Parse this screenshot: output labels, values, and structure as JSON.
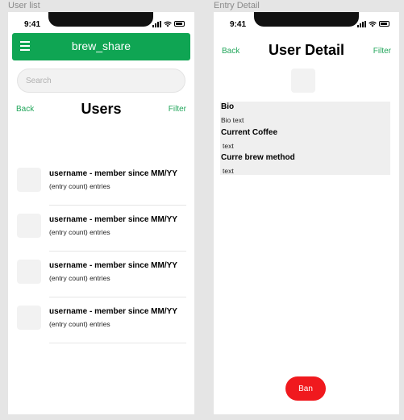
{
  "frames": {
    "user_list_label": "User list",
    "entry_detail_label": "Entry Detail"
  },
  "status_bar": {
    "time": "9:41"
  },
  "user_list": {
    "app_title": "brew_share",
    "search_placeholder": "Search",
    "back_label": "Back",
    "page_title": "Users",
    "filter_label": "Filter",
    "users": [
      {
        "name": "username -  member since MM/YY",
        "entries": "(entry count) entries"
      },
      {
        "name": "username -  member since MM/YY",
        "entries": "(entry count) entries"
      },
      {
        "name": "username -  member since MM/YY",
        "entries": "(entry count) entries"
      },
      {
        "name": "username -  member since MM/YY",
        "entries": "(entry count) entries"
      }
    ]
  },
  "user_detail": {
    "back_label": "Back",
    "page_title": "User Detail",
    "filter_label": "Filter",
    "bio_label": "Bio",
    "bio_value": "Bio text",
    "coffee_label": "Current Coffee",
    "coffee_value": "text",
    "brew_label": "Curre brew method",
    "brew_value": "text",
    "ban_label": "Ban"
  },
  "colors": {
    "brand_green": "#0fa553",
    "link_green": "#22a65b",
    "ban_red": "#f0191e"
  }
}
